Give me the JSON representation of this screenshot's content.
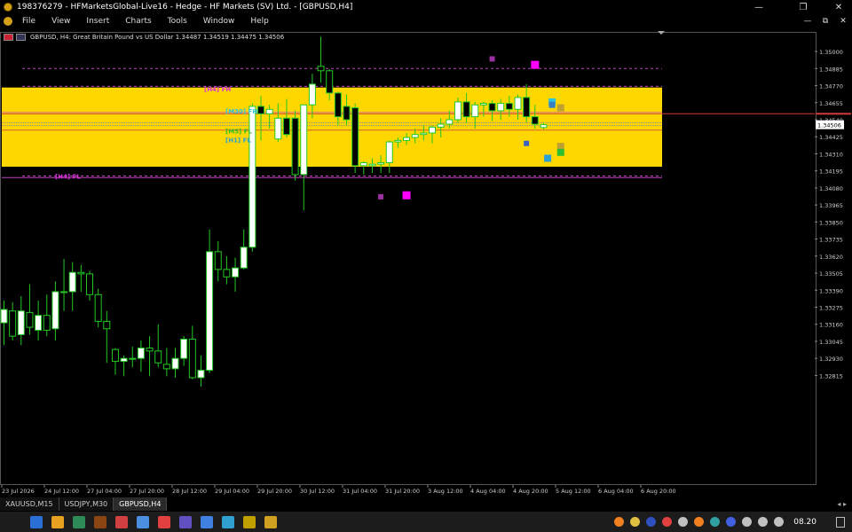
{
  "window": {
    "title": "198376279 - HFMarketsGlobal-Live16 - Hedge - HF Markets (SV) Ltd. - [GBPUSD,H4]",
    "controls": {
      "minimize": "—",
      "maximize": "❐",
      "close": "✕"
    }
  },
  "menu": {
    "items": [
      "File",
      "View",
      "Insert",
      "Charts",
      "Tools",
      "Window",
      "Help"
    ],
    "mdi_controls": {
      "minimize": "—",
      "restore": "⧉",
      "close": "✕"
    }
  },
  "chart": {
    "header": "GBPUSD, H4:  Great Britain Pound vs US Dollar  1.34487 1.34519 1.34475 1.34506",
    "current_price": "1.34506",
    "colors": {
      "zone": "#FFD700",
      "bull_body": "#FFFFFF",
      "bear_body": "#000000",
      "wick": "#22C922",
      "magenta": "#FF00FF",
      "purple": "#9B30A0",
      "price_line": "#D43A3A"
    },
    "zone_labels": [
      {
        "text": "[H4] FH",
        "color": "#D933D9",
        "price": 1.3475
      },
      {
        "text": "[M30] FH",
        "color": "#2CC5E0",
        "price": 1.346
      },
      {
        "text": "[M5] FL",
        "color": "#2FBF2F",
        "price": 1.34465
      },
      {
        "text": "[H1] FL",
        "color": "#2A9FD6",
        "price": 1.34405
      },
      {
        "text": "[H4] FL",
        "color": "#D933D9",
        "price": 1.3416
      }
    ]
  },
  "chart_data": {
    "type": "candlestick",
    "symbol": "GBPUSD",
    "timeframe": "H4",
    "ylim": [
      1.321,
      1.3512
    ],
    "y_ticks": [
      1.35,
      1.34885,
      1.3477,
      1.34655,
      1.3454,
      1.34425,
      1.3431,
      1.34195,
      1.3408,
      1.33965,
      1.3385,
      1.33735,
      1.3362,
      1.33505,
      1.3339,
      1.33275,
      1.3316,
      1.33045,
      1.3293,
      1.32815
    ],
    "x_labels": [
      "23 Jul 2026",
      "24 Jul 12:00",
      "27 Jul 04:00",
      "27 Jul 20:00",
      "28 Jul 12:00",
      "29 Jul 04:00",
      "29 Jul 20:00",
      "30 Jul 12:00",
      "31 Jul 04:00",
      "31 Jul 20:00",
      "3 Aug 12:00",
      "4 Aug 04:00",
      "4 Aug 20:00",
      "5 Aug 12:00",
      "6 Aug 04:00",
      "6 Aug 20:00"
    ],
    "zone": {
      "top": 1.34757,
      "bottom": 1.34223
    },
    "level_lines": [
      {
        "price": 1.34885,
        "color": "#C040C0",
        "style": "dashed"
      },
      {
        "price": 1.34765,
        "color": "#C040C0",
        "style": "dashed"
      },
      {
        "price": 1.3459,
        "color": "#E08080",
        "style": "solid"
      },
      {
        "price": 1.3452,
        "color": "#888888",
        "style": "dotted"
      },
      {
        "price": 1.345,
        "color": "#888888",
        "style": "dotted"
      },
      {
        "price": 1.3447,
        "color": "#D06030",
        "style": "solid"
      },
      {
        "price": 1.3416,
        "color": "#C040C0",
        "style": "dashed"
      },
      {
        "price": 1.3415,
        "color": "#C040C0",
        "style": "solid"
      }
    ],
    "candles": [
      {
        "o": 1.3317,
        "h": 1.3332,
        "l": 1.3302,
        "c": 1.3326
      },
      {
        "o": 1.3325,
        "h": 1.3331,
        "l": 1.3305,
        "c": 1.3308
      },
      {
        "o": 1.3309,
        "h": 1.3335,
        "l": 1.3302,
        "c": 1.3325
      },
      {
        "o": 1.3324,
        "h": 1.3343,
        "l": 1.3309,
        "c": 1.3314
      },
      {
        "o": 1.3312,
        "h": 1.3332,
        "l": 1.3305,
        "c": 1.3322
      },
      {
        "o": 1.3322,
        "h": 1.3336,
        "l": 1.3308,
        "c": 1.3312
      },
      {
        "o": 1.3313,
        "h": 1.3345,
        "l": 1.3305,
        "c": 1.3338
      },
      {
        "o": 1.3338,
        "h": 1.336,
        "l": 1.3325,
        "c": 1.3338
      },
      {
        "o": 1.3338,
        "h": 1.3358,
        "l": 1.3325,
        "c": 1.3351
      },
      {
        "o": 1.3351,
        "h": 1.3356,
        "l": 1.3338,
        "c": 1.335
      },
      {
        "o": 1.335,
        "h": 1.3352,
        "l": 1.3332,
        "c": 1.3336
      },
      {
        "o": 1.3336,
        "h": 1.334,
        "l": 1.3314,
        "c": 1.3318
      },
      {
        "o": 1.3318,
        "h": 1.3325,
        "l": 1.329,
        "c": 1.3313
      },
      {
        "o": 1.3299,
        "h": 1.33,
        "l": 1.3282,
        "c": 1.3291
      },
      {
        "o": 1.3291,
        "h": 1.3295,
        "l": 1.3281,
        "c": 1.3293
      },
      {
        "o": 1.3293,
        "h": 1.3301,
        "l": 1.3287,
        "c": 1.3293
      },
      {
        "o": 1.3293,
        "h": 1.3305,
        "l": 1.3284,
        "c": 1.33
      },
      {
        "o": 1.33,
        "h": 1.3308,
        "l": 1.3281,
        "c": 1.3298
      },
      {
        "o": 1.3298,
        "h": 1.3316,
        "l": 1.3287,
        "c": 1.329
      },
      {
        "o": 1.3289,
        "h": 1.33,
        "l": 1.3281,
        "c": 1.3286
      },
      {
        "o": 1.3286,
        "h": 1.33,
        "l": 1.328,
        "c": 1.3293
      },
      {
        "o": 1.3293,
        "h": 1.3308,
        "l": 1.3288,
        "c": 1.3306
      },
      {
        "o": 1.3306,
        "h": 1.3315,
        "l": 1.3279,
        "c": 1.328
      },
      {
        "o": 1.328,
        "h": 1.3295,
        "l": 1.3274,
        "c": 1.3285
      },
      {
        "o": 1.3285,
        "h": 1.338,
        "l": 1.3283,
        "c": 1.3365
      },
      {
        "o": 1.3365,
        "h": 1.3372,
        "l": 1.3345,
        "c": 1.3353
      },
      {
        "o": 1.3353,
        "h": 1.3362,
        "l": 1.3343,
        "c": 1.3348
      },
      {
        "o": 1.3348,
        "h": 1.3361,
        "l": 1.3338,
        "c": 1.3354
      },
      {
        "o": 1.3354,
        "h": 1.338,
        "l": 1.3353,
        "c": 1.3368
      },
      {
        "o": 1.3368,
        "h": 1.3465,
        "l": 1.3365,
        "c": 1.3463
      },
      {
        "o": 1.3463,
        "h": 1.347,
        "l": 1.344,
        "c": 1.3458
      },
      {
        "o": 1.3458,
        "h": 1.3464,
        "l": 1.3448,
        "c": 1.3461
      },
      {
        "o": 1.3441,
        "h": 1.3465,
        "l": 1.3439,
        "c": 1.3455
      },
      {
        "o": 1.3455,
        "h": 1.3468,
        "l": 1.3442,
        "c": 1.3444
      },
      {
        "o": 1.3455,
        "h": 1.346,
        "l": 1.3413,
        "c": 1.3417
      },
      {
        "o": 1.3417,
        "h": 1.346,
        "l": 1.3393,
        "c": 1.3464
      },
      {
        "o": 1.3464,
        "h": 1.3485,
        "l": 1.3455,
        "c": 1.3478
      },
      {
        "o": 1.349,
        "h": 1.351,
        "l": 1.3479,
        "c": 1.3487
      },
      {
        "o": 1.3487,
        "h": 1.3488,
        "l": 1.3467,
        "c": 1.3472
      },
      {
        "o": 1.3472,
        "h": 1.3473,
        "l": 1.345,
        "c": 1.3456
      },
      {
        "o": 1.3463,
        "h": 1.3471,
        "l": 1.345,
        "c": 1.3454
      },
      {
        "o": 1.3462,
        "h": 1.3465,
        "l": 1.3418,
        "c": 1.3423
      },
      {
        "o": 1.3423,
        "h": 1.3426,
        "l": 1.3417,
        "c": 1.3425
      },
      {
        "o": 1.3423,
        "h": 1.3428,
        "l": 1.3418,
        "c": 1.3424
      },
      {
        "o": 1.3424,
        "h": 1.343,
        "l": 1.3418,
        "c": 1.3425
      },
      {
        "o": 1.3425,
        "h": 1.344,
        "l": 1.3418,
        "c": 1.3439
      },
      {
        "o": 1.3439,
        "h": 1.3442,
        "l": 1.3435,
        "c": 1.344
      },
      {
        "o": 1.344,
        "h": 1.3445,
        "l": 1.3437,
        "c": 1.3442
      },
      {
        "o": 1.3442,
        "h": 1.3448,
        "l": 1.3438,
        "c": 1.3444
      },
      {
        "o": 1.3444,
        "h": 1.345,
        "l": 1.344,
        "c": 1.3445
      },
      {
        "o": 1.3445,
        "h": 1.345,
        "l": 1.3438,
        "c": 1.3449
      },
      {
        "o": 1.3449,
        "h": 1.3455,
        "l": 1.3442,
        "c": 1.3451
      },
      {
        "o": 1.3451,
        "h": 1.346,
        "l": 1.3448,
        "c": 1.3454
      },
      {
        "o": 1.3454,
        "h": 1.3469,
        "l": 1.3452,
        "c": 1.3466
      },
      {
        "o": 1.3466,
        "h": 1.3472,
        "l": 1.3452,
        "c": 1.3456
      },
      {
        "o": 1.3456,
        "h": 1.3466,
        "l": 1.3448,
        "c": 1.3464
      },
      {
        "o": 1.3464,
        "h": 1.3466,
        "l": 1.3456,
        "c": 1.3465
      },
      {
        "o": 1.3465,
        "h": 1.3467,
        "l": 1.3453,
        "c": 1.346
      },
      {
        "o": 1.346,
        "h": 1.3468,
        "l": 1.3454,
        "c": 1.3465
      },
      {
        "o": 1.3465,
        "h": 1.347,
        "l": 1.3456,
        "c": 1.3461
      },
      {
        "o": 1.3461,
        "h": 1.3471,
        "l": 1.3454,
        "c": 1.3469
      },
      {
        "o": 1.3469,
        "h": 1.3478,
        "l": 1.3452,
        "c": 1.3456
      },
      {
        "o": 1.3456,
        "h": 1.3464,
        "l": 1.3448,
        "c": 1.3451
      },
      {
        "o": 1.34487,
        "h": 1.34519,
        "l": 1.34475,
        "c": 1.34506
      }
    ],
    "markers": [
      {
        "index": 57,
        "price": 1.3495,
        "color": "#9B30A0",
        "size": 6
      },
      {
        "index": 62,
        "price": 1.3491,
        "color": "#FF00FF",
        "size": 9
      },
      {
        "index": 44,
        "price": 1.3402,
        "color": "#9B30A0",
        "size": 6
      },
      {
        "index": 47,
        "price": 1.3403,
        "color": "#FF00FF",
        "size": 9
      },
      {
        "index": 61,
        "price": 1.3438,
        "color": "#3A60C0",
        "size": 6
      },
      {
        "index": 64,
        "price": 1.3466,
        "color": "#2CC5E0",
        "size": 8
      },
      {
        "index": 64,
        "price": 1.3464,
        "color": "#3A80C0",
        "size": 7
      },
      {
        "index": 65,
        "price": 1.3462,
        "color": "#C0A030",
        "size": 8
      },
      {
        "index": 65,
        "price": 1.3436,
        "color": "#C0A030",
        "size": 8
      },
      {
        "index": 65,
        "price": 1.3432,
        "color": "#2FBF2F",
        "size": 8
      },
      {
        "index": 64,
        "price": 1.3428,
        "color": "#2A9FD6",
        "size": 8
      }
    ]
  },
  "tabs": {
    "items": [
      "XAUUSD,M15",
      "USDJPY,M30",
      "GBPUSD,H4"
    ],
    "active": 2,
    "scroll": "◂ ▸"
  },
  "taskbar": {
    "icons": [
      "#2A6FD6",
      "#E8A020",
      "#2E8B57",
      "#8B4513",
      "#D04040",
      "#4A8FE0",
      "#E04040",
      "#6050C0",
      "#4080E0",
      "#30A0D0",
      "#C0A000",
      "#D0A020"
    ],
    "tray_icons": [
      "#F08020",
      "#E0C040",
      "#3050C0",
      "#E04040",
      "#C0C0C0",
      "#F08020",
      "#30A0A0",
      "#4060E0",
      "#C0C0C0",
      "#C0C0C0",
      "#C0C0C0"
    ],
    "clock": "08.20"
  }
}
